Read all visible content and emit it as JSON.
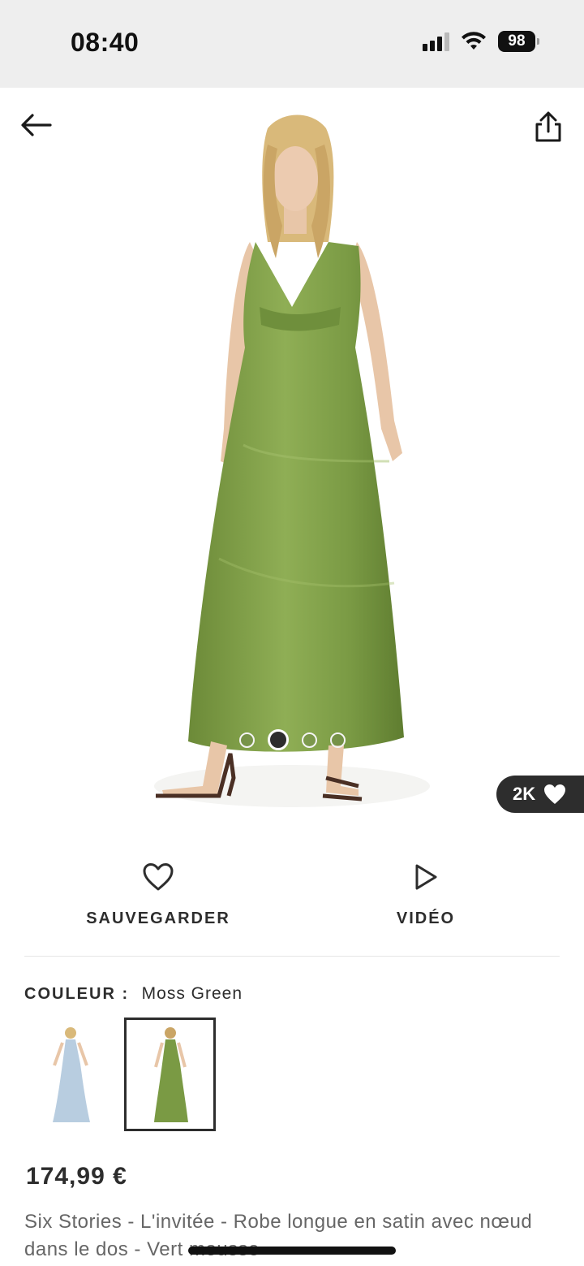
{
  "status_bar": {
    "time": "08:40",
    "battery": "98"
  },
  "hero": {
    "likes": "2K",
    "carousel": {
      "count": 4,
      "active_index": 1
    },
    "dress_color": "#7a9a44"
  },
  "actions": {
    "save_label": "SAUVEGARDER",
    "video_label": "VIDÉO"
  },
  "color": {
    "label": "COULEUR :",
    "value": "Moss Green",
    "swatches": [
      {
        "name": "blue-dress",
        "color": "#b8cde0",
        "selected": false
      },
      {
        "name": "moss-green-dress",
        "color": "#7a9a44",
        "selected": true
      }
    ]
  },
  "product": {
    "price": "174,99 €",
    "name": "Six Stories - L'invitée - Robe longue en satin avec nœud dans le dos - Vert mousse"
  }
}
